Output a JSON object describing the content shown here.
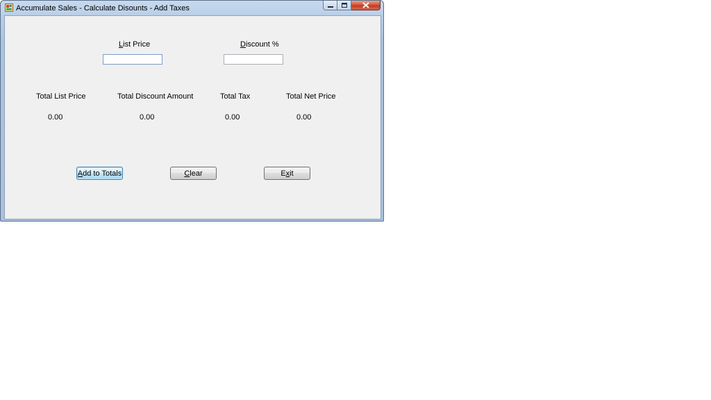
{
  "window": {
    "title": "Accumulate Sales - Calculate Disounts - Add Taxes",
    "controls": {
      "minimize_icon": "minimize-icon",
      "maximize_icon": "maximize-icon",
      "close_icon": "close-icon"
    }
  },
  "inputs": {
    "list_price": {
      "label_access_key": "L",
      "label_rest": "ist Price",
      "value": ""
    },
    "discount": {
      "label_access_key": "D",
      "label_rest": "iscount %",
      "value": ""
    }
  },
  "totals": {
    "list_price": {
      "label": "Total List Price",
      "value": "0.00"
    },
    "discount_amount": {
      "label": "Total Discount Amount",
      "value": "0.00"
    },
    "tax": {
      "label": "Total Tax",
      "value": "0.00"
    },
    "net_price": {
      "label": "Total Net Price",
      "value": "0.00"
    }
  },
  "buttons": {
    "add_to_totals": {
      "access_key": "A",
      "rest": "dd to Totals"
    },
    "clear": {
      "access_key": "C",
      "rest": "lear"
    },
    "exit": {
      "pre": "E",
      "access_key": "x",
      "rest": "it"
    }
  },
  "colors": {
    "client_background": "#f0f0f0",
    "title_gradient_top": "#c7d9ee",
    "close_button": "#c33c24",
    "textbox_border": "#7a9cc8",
    "default_button_border": "#3c7fb1"
  }
}
